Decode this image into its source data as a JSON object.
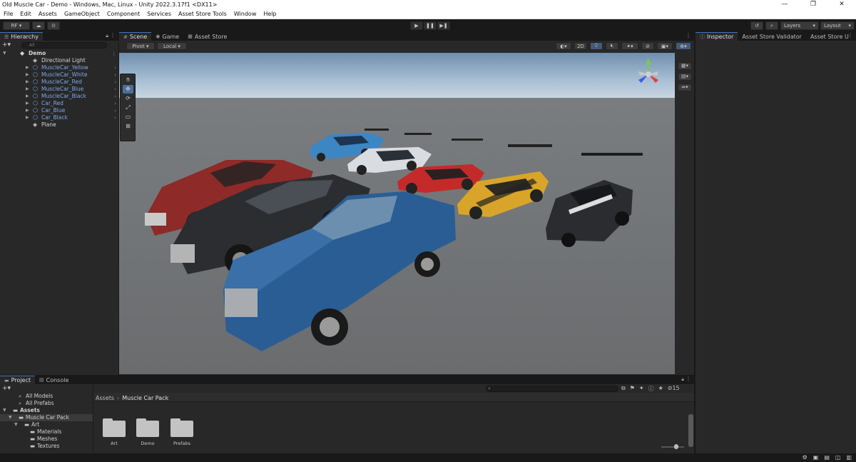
{
  "window": {
    "title": "Old Muscle Car - Demo - Windows, Mac, Linux - Unity 2022.3.17f1 <DX11>",
    "minimize": "—",
    "maximize": "❐",
    "close": "✕"
  },
  "menu": [
    "File",
    "Edit",
    "Assets",
    "GameObject",
    "Component",
    "Services",
    "Asset Store Tools",
    "Window",
    "Help"
  ],
  "toolbar": {
    "account": "RF ▾",
    "cloud_icon": "☁",
    "collab_icon": "⊙",
    "play": "▶",
    "pause": "❚❚",
    "step": "▶❚",
    "history_icon": "↺",
    "search_icon": "⌕",
    "layers": "Layers",
    "layout": "Layout"
  },
  "hierarchy": {
    "tab": "Hierarchy",
    "search_placeholder": "All",
    "items": [
      {
        "label": "Demo",
        "depth": 0,
        "color": "white",
        "icon": "◆",
        "expanded": true
      },
      {
        "label": "Directional Light",
        "depth": 1,
        "color": "white",
        "icon": "◈"
      },
      {
        "label": "MuscleCar_Yellow",
        "depth": 1,
        "color": "blue",
        "icon": "⬡",
        "arrow": true
      },
      {
        "label": "MuscleCar_White",
        "depth": 1,
        "color": "blue",
        "icon": "⬡",
        "arrow": true
      },
      {
        "label": "MuscleCar_Red",
        "depth": 1,
        "color": "blue",
        "icon": "⬡",
        "arrow": true
      },
      {
        "label": "MuscleCar_Blue",
        "depth": 1,
        "color": "blue",
        "icon": "⬡",
        "arrow": true
      },
      {
        "label": "MuscleCar_Black",
        "depth": 1,
        "color": "blue",
        "icon": "⬡",
        "arrow": true
      },
      {
        "label": "Car_Red",
        "depth": 1,
        "color": "blue",
        "icon": "⬡",
        "arrow": true
      },
      {
        "label": "Car_Blue",
        "depth": 1,
        "color": "blue",
        "icon": "⬡",
        "arrow": true
      },
      {
        "label": "Car_Black",
        "depth": 1,
        "color": "blue",
        "icon": "⬡",
        "arrow": true
      },
      {
        "label": "Plane",
        "depth": 1,
        "color": "white",
        "icon": "◈"
      }
    ]
  },
  "scene": {
    "tabs": [
      "Scene",
      "Game",
      "Asset Store"
    ],
    "pivot": "Pivot ▾",
    "local": "Local ▾",
    "mode_2d": "2D"
  },
  "inspector": {
    "tabs": [
      "Inspector",
      "Asset Store Validator",
      "Asset Store U"
    ]
  },
  "project": {
    "tabs": [
      "Project",
      "Console"
    ],
    "tree": [
      {
        "label": "All Models",
        "depth": 1,
        "icon": "⌕"
      },
      {
        "label": "All Prefabs",
        "depth": 1,
        "icon": "⌕"
      },
      {
        "label": "Assets",
        "depth": 0,
        "icon": "▬",
        "bold": true
      },
      {
        "label": "Muscle Car Pack",
        "depth": 1,
        "icon": "▬",
        "selected": true
      },
      {
        "label": "Art",
        "depth": 2,
        "icon": "▬"
      },
      {
        "label": "Materials",
        "depth": 3,
        "icon": "▬"
      },
      {
        "label": "Meshes",
        "depth": 3,
        "icon": "▬"
      },
      {
        "label": "Textures",
        "depth": 3,
        "icon": "▬"
      }
    ],
    "breadcrumb": [
      "Assets",
      "›",
      "Muscle Car Pack"
    ],
    "folders": [
      "Art",
      "Demo",
      "Prefabs"
    ],
    "hidden_count": "15"
  }
}
